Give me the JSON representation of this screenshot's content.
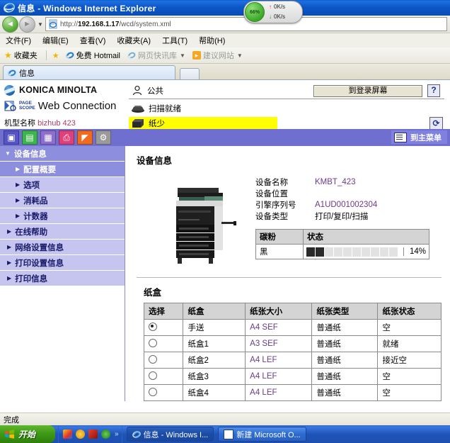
{
  "window": {
    "title": "信息 - Windows Internet Explorer",
    "icon": "ie-logo-icon"
  },
  "netmonitor": {
    "percent": "66%",
    "upload_speed": "0K/s",
    "download_speed": "0K/s",
    "up_arrow": "↑",
    "down_arrow": "↓"
  },
  "address_bar": {
    "back_glyph": "◄",
    "forward_glyph": "►",
    "dropdown_glyph": "▼",
    "url_prefix": "http://",
    "url_host": "192.168.1.17",
    "url_path": "/wcd/system.xml"
  },
  "menu": {
    "items": [
      {
        "label": "文件(F)"
      },
      {
        "label": "编辑(E)"
      },
      {
        "label": "查看(V)"
      },
      {
        "label": "收藏夹(A)"
      },
      {
        "label": "工具(T)"
      },
      {
        "label": "帮助(H)"
      }
    ]
  },
  "favorites_bar": {
    "favorites_label": "收藏夹",
    "items": [
      {
        "label": "免费 Hotmail",
        "icon": "ie-logo-icon",
        "caret": ""
      },
      {
        "label": "网页快讯库",
        "icon": "ie-logo-icon",
        "caret": "▼"
      },
      {
        "label": "建议网站",
        "icon": "rss-icon",
        "caret": "▼"
      }
    ]
  },
  "browser_tab": {
    "label": "信息",
    "icon": "ie-logo-icon"
  },
  "brand": {
    "company": "KONICA MINOLTA",
    "pagescope_line1": "PAGE",
    "pagescope_line2": "SCOPE",
    "product": "Web Connection",
    "model_label": "机型名称",
    "model_value": "bizhub 423"
  },
  "header": {
    "user_icon": "user-icon",
    "user_label": "公共",
    "login_button": "到登录屏幕",
    "help_button": "?",
    "refresh_button": "⟳",
    "statuses": [
      {
        "label": "扫描就绪",
        "highlight": false,
        "icon": "scanner-icon"
      },
      {
        "label": "纸少",
        "highlight": true,
        "icon": "printer-icon"
      }
    ],
    "highlight_color": "#ffff00"
  },
  "icon_tabs": {
    "tabs": [
      {
        "name": "device-information-tab",
        "glyph": "▣",
        "color": "#5555c8",
        "active": true
      },
      {
        "name": "document-tab",
        "glyph": "▤",
        "color": "#3cb54a",
        "active": false
      },
      {
        "name": "box-tab",
        "glyph": "▦",
        "color": "#8e6fd0",
        "active": false
      },
      {
        "name": "print-tab",
        "glyph": "⎙",
        "color": "#e0407a",
        "active": false
      },
      {
        "name": "scan-tab",
        "glyph": "◤",
        "color": "#f06a20",
        "active": false
      },
      {
        "name": "settings-tab",
        "glyph": "⚙",
        "color": "#9a9a9a",
        "active": false
      }
    ],
    "main_menu_label": "到主菜单"
  },
  "sidebar": {
    "header": "设备信息",
    "header_arrow": "▼",
    "items": [
      {
        "label": "配置概要",
        "arrow": "▶",
        "sub": true,
        "selected": true
      },
      {
        "label": "选项",
        "arrow": "▶",
        "sub": true,
        "selected": false
      },
      {
        "label": "消耗品",
        "arrow": "▶",
        "sub": true,
        "selected": false
      },
      {
        "label": "计数器",
        "arrow": "▶",
        "sub": true,
        "selected": false
      },
      {
        "label": "在线帮助",
        "arrow": "▶",
        "sub": false,
        "selected": false
      },
      {
        "label": "网络设置信息",
        "arrow": "▶",
        "sub": false,
        "selected": false
      },
      {
        "label": "打印设置信息",
        "arrow": "▶",
        "sub": false,
        "selected": false
      },
      {
        "label": "打印信息",
        "arrow": "▶",
        "sub": false,
        "selected": false
      }
    ]
  },
  "device_info": {
    "title": "设备信息",
    "fields": [
      {
        "label": "设备名称",
        "value": "KMBT_423",
        "accent": true
      },
      {
        "label": "设备位置",
        "value": "",
        "accent": true
      },
      {
        "label": "引擎序列号",
        "value": "A1UD001002304",
        "accent": true
      },
      {
        "label": "设备类型",
        "value": "打印/复印/扫描",
        "accent": false
      }
    ],
    "toner": {
      "col_name": "碳粉",
      "col_status": "状态",
      "rows": [
        {
          "name": "黑",
          "percent_label": "14%",
          "filled_segments": 2,
          "total_segments": 10
        }
      ]
    }
  },
  "paper_trays": {
    "title": "纸盒",
    "columns": [
      "选择",
      "纸盒",
      "纸张大小",
      "纸张类型",
      "纸张状态"
    ],
    "rows": [
      {
        "selected": true,
        "tray": "手送",
        "size": "A4 SEF",
        "type": "普通纸",
        "status": "空"
      },
      {
        "selected": false,
        "tray": "纸盒1",
        "size": "A3 SEF",
        "type": "普通纸",
        "status": "就绪"
      },
      {
        "selected": false,
        "tray": "纸盒2",
        "size": "A4 LEF",
        "type": "普通纸",
        "status": "接近空"
      },
      {
        "selected": false,
        "tray": "纸盒3",
        "size": "A4 LEF",
        "type": "普通纸",
        "status": "空"
      },
      {
        "selected": false,
        "tray": "纸盒4",
        "size": "A4 LEF",
        "type": "普通纸",
        "status": "空"
      }
    ]
  },
  "status_bar": {
    "text": "完成"
  },
  "taskbar": {
    "start_label": "开始",
    "quick_launch_more": "»",
    "buttons": [
      {
        "label": "信息 - Windows I...",
        "icon": "ie-logo-icon",
        "active": true
      },
      {
        "label": "新建 Microsoft O...",
        "icon": "word-icon",
        "active": false
      }
    ]
  }
}
